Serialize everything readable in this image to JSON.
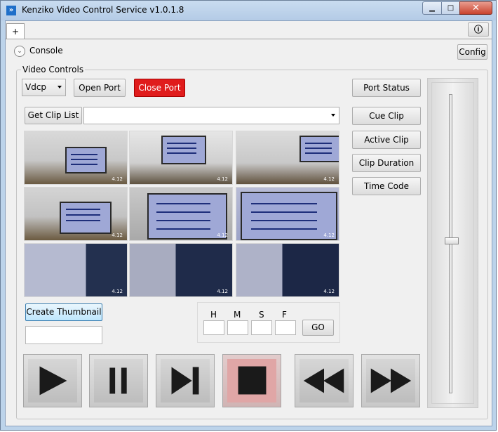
{
  "window": {
    "title": "Kenziko Video Control Service v1.0.1.8",
    "app_icon": "»"
  },
  "titlebar_buttons": {
    "minimize": "▁",
    "maximize": "□",
    "close": "✕"
  },
  "tabs": {
    "add_label": "+"
  },
  "toolbar": {
    "info_label": "ⓘ",
    "config_label": "Config"
  },
  "console": {
    "chevron": "⌄",
    "label": "Console"
  },
  "video_controls": {
    "group_label": "Video Controls",
    "protocol_select": {
      "value": "Vdcp"
    },
    "open_port_label": "Open Port",
    "close_port_label": "Close Port",
    "port_status_label": "Port Status",
    "get_clip_list_label": "Get Clip List",
    "clip_list_value": "",
    "cue_clip_label": "Cue Clip",
    "active_clip_label": "Active Clip",
    "clip_duration_label": "Clip Duration",
    "time_code_label": "Time Code",
    "create_thumbnail_label": "Create Thumbnail",
    "thumbnail_name_value": "",
    "timecode": {
      "h_label": "H",
      "m_label": "M",
      "s_label": "S",
      "f_label": "F",
      "h_value": "",
      "m_value": "",
      "s_value": "",
      "f_value": "",
      "go_label": "GO"
    }
  },
  "transport": {
    "play": "play-icon",
    "pause": "pause-icon",
    "next": "skip-next-icon",
    "stop": "stop-icon",
    "rewind": "rewind-icon",
    "fast_forward": "fast-forward-icon"
  },
  "volume_slider": {
    "level": 0.51
  },
  "colors": {
    "close_port": "#e01c1c",
    "stop_button": "#e0a6a6",
    "titlebar": "#bcd3ea"
  }
}
